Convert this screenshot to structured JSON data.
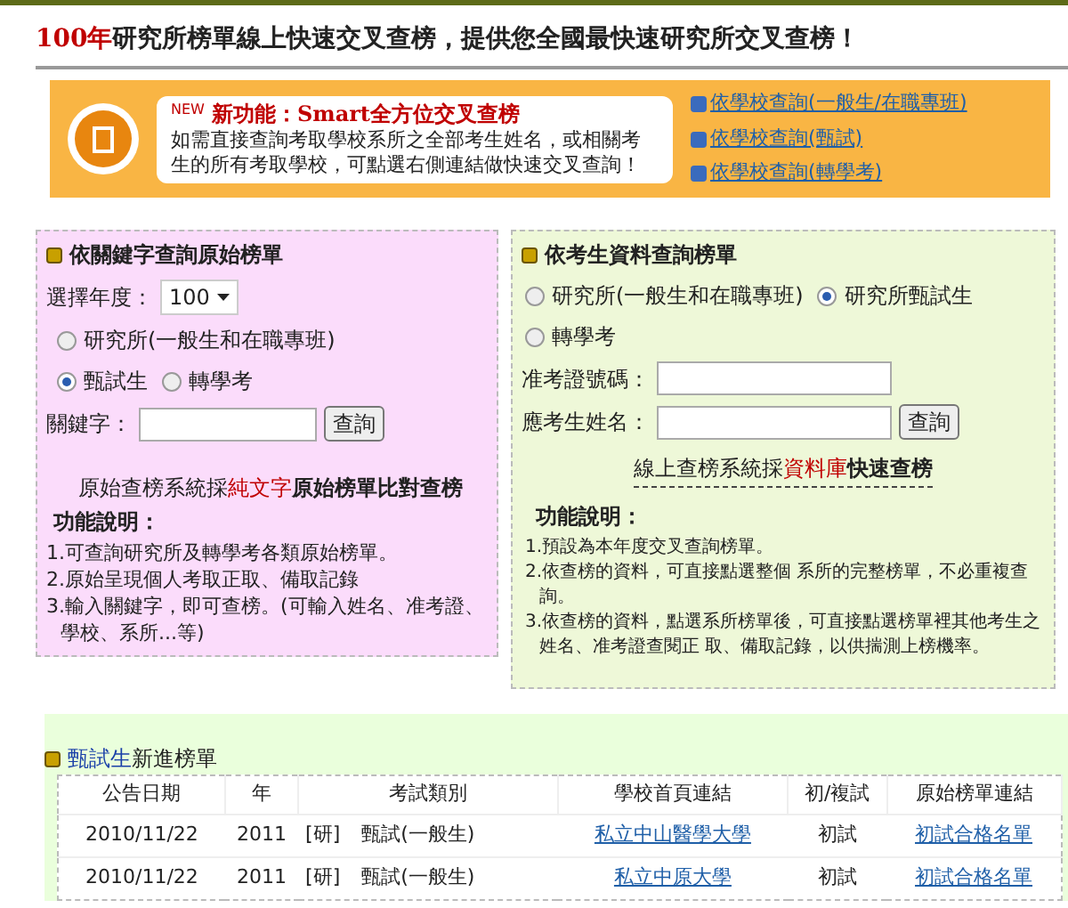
{
  "headline": [
    {
      "kind": "red",
      "text": "100年"
    },
    {
      "kind": "plain",
      "text": "研究所榜單線上快速交叉查榜，提供您全國最快速研究所交叉查榜！"
    }
  ],
  "banner": {
    "badge": "NEW",
    "title": "新功能：Smart全方位交叉查榜",
    "description": "如需直接查詢考取學校系所之全部考生姓名，或相關考生的所有考取學校，可點選右側連結做快速交叉查詢！",
    "links": [
      "依學校查詢(一般生/在職專班)",
      "依學校查詢(甄試)",
      "依學校查詢(轉學考)"
    ]
  },
  "keyword_panel": {
    "title": "依關鍵字查詢原始榜單",
    "year_label": "選擇年度：",
    "year": "100",
    "options": [
      {
        "label": "研究所(一般生和在職專班)",
        "selected": false
      },
      {
        "label": "甄試生",
        "selected": true
      },
      {
        "label": "轉學考",
        "selected": false
      }
    ],
    "keyword_label": "關鍵字：",
    "button": "查詢",
    "note": [
      {
        "kind": "plain",
        "text": "原始查榜系統採"
      },
      {
        "kind": "red",
        "text": "純文字"
      },
      {
        "kind": "bold",
        "text": "原始榜單比對查榜"
      }
    ],
    "help_title": "功能說明：",
    "help": [
      "1.可查詢研究所及轉學考各類原始榜單。",
      "2.原始呈現個人考取正取、備取記錄",
      "3.輸入關鍵字，即可查榜。(可輸入姓名、准考證、學校、系所...等)"
    ]
  },
  "student_panel": {
    "title": "依考生資料查詢榜單",
    "options": [
      {
        "label": "研究所(一般生和在職專班)",
        "selected": false
      },
      {
        "label": "研究所甄試生",
        "selected": true
      },
      {
        "label": "轉學考",
        "selected": false
      }
    ],
    "id_label": "准考證號碼：",
    "name_label": "應考生姓名：",
    "button": "查詢",
    "note": [
      {
        "kind": "plain",
        "text": "線上查榜系統採"
      },
      {
        "kind": "red",
        "text": "資料庫"
      },
      {
        "kind": "bold",
        "text": "快速查榜"
      }
    ],
    "help_title": "功能說明：",
    "help": [
      "1.預設為本年度交叉查詢榜單。",
      "2.依查榜的資料，可直接點選整個 系所的完整榜單，不必重複查詢。",
      "3.依查榜的資料，點選系所榜單後，可直接點選榜單裡其他考生之姓名、准考證查閱正 取、備取記錄，以供揣測上榜機率。"
    ]
  },
  "new_lists": {
    "title": [
      {
        "kind": "blue",
        "text": "甄試生"
      },
      {
        "kind": "plain",
        "text": "新進榜單"
      }
    ],
    "columns": [
      "公告日期",
      "年",
      "考試類別",
      "學校首頁連結",
      "初/複試",
      "原始榜單連結"
    ],
    "rows": [
      {
        "date": "2010/11/22",
        "year": "2011",
        "tag": "[研]",
        "category": "甄試(一般生)",
        "school": "私立中山醫學大學",
        "stage": "初試",
        "list": "初試合格名單"
      },
      {
        "date": "2010/11/22",
        "year": "2011",
        "tag": "[研]",
        "category": "甄試(一般生)",
        "school": "私立中原大學",
        "stage": "初試",
        "list": "初試合格名單"
      }
    ]
  }
}
